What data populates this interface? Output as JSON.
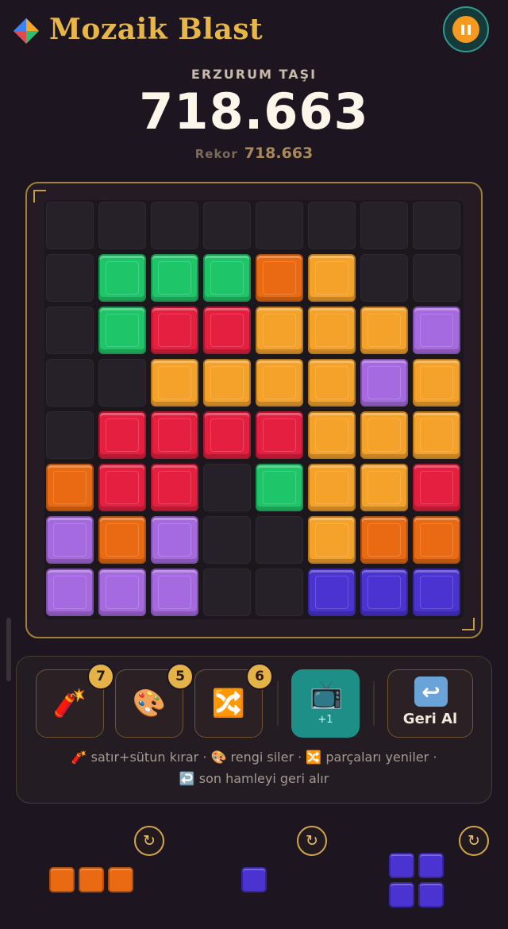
{
  "header": {
    "title": "Mozaik Blast",
    "pause_icon": "pause-icon"
  },
  "level": {
    "name": "ERZURUM TAŞI",
    "score": "718.663",
    "record_label": "Rekor",
    "record_value": "718.663"
  },
  "colors": {
    "G": "#1fc569",
    "R": "#e41f3f",
    "O": "#f5a22a",
    "D": "#e96a12",
    "P": "#a66ae0",
    "B": "#4a33d0"
  },
  "board": {
    "rows": [
      "........",
      ".GGGDO..",
      ".GRROOOP",
      "..OOOOPO",
      ".RRRROOO",
      "DRR.GOOR",
      "PDP..ODD",
      "PPP..BBB"
    ]
  },
  "tools": [
    {
      "name": "dynamite",
      "icon": "dynamite-icon",
      "emoji": "🧨",
      "count": "7"
    },
    {
      "name": "palette",
      "icon": "palette-icon",
      "emoji": "🎨",
      "count": "5"
    },
    {
      "name": "shuffle",
      "icon": "shuffle-icon",
      "emoji": "🔀",
      "count": "6"
    }
  ],
  "ad_button": {
    "icon": "tv-icon",
    "emoji": "📺",
    "label": "+1"
  },
  "undo_button": {
    "icon": "undo-icon",
    "symbol": "↩",
    "label": "Geri Al"
  },
  "help": {
    "line1": "🧨 satır+sütun kırar · 🎨 rengi siler · 🔀 parçaları yeniler ·",
    "line2": "↩️ son hamleyi geri alır"
  },
  "pieces": [
    {
      "color": "D",
      "cells": [
        [
          0,
          0
        ],
        [
          0,
          1
        ],
        [
          0,
          2
        ]
      ]
    },
    {
      "color": "B",
      "cells": [
        [
          0,
          0
        ]
      ]
    },
    {
      "color": "B",
      "cells": [
        [
          0,
          0
        ],
        [
          0,
          1
        ],
        [
          1,
          0
        ],
        [
          1,
          1
        ]
      ]
    }
  ],
  "rotate_icon": "↻"
}
